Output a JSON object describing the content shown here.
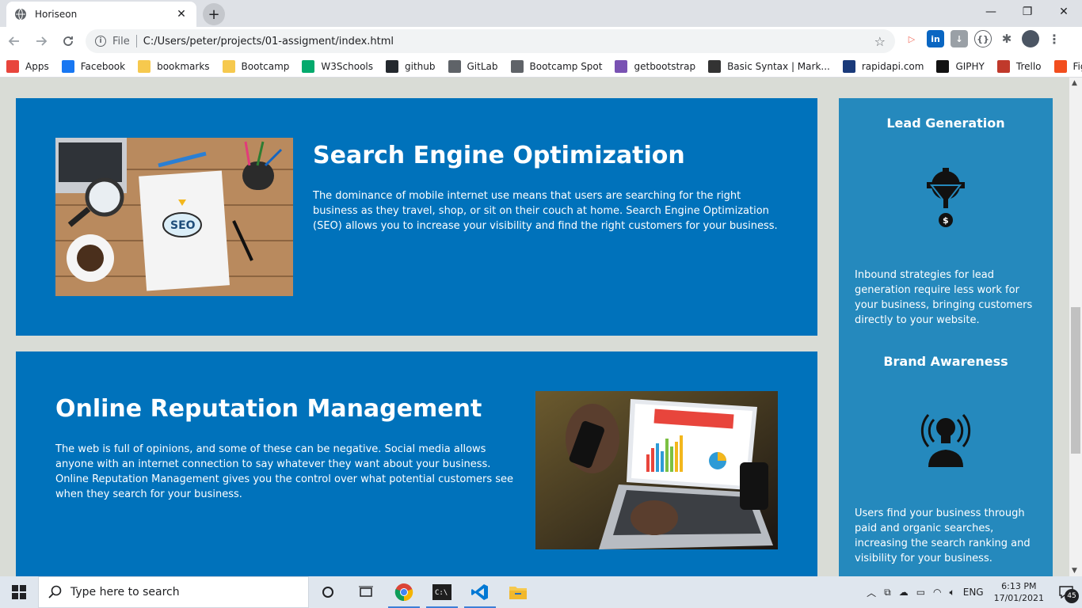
{
  "browser": {
    "tab_title": "Horiseon",
    "tab_close": "✕",
    "new_tab": "+",
    "window_controls": [
      "—",
      "❐",
      "✕"
    ],
    "scheme_label": "File",
    "url": "C:/Users/peter/projects/01-assigment/index.html",
    "bookmarks": [
      {
        "label": "Apps",
        "icon": "apps-grid-icon",
        "color": "#e8453c"
      },
      {
        "label": "Facebook",
        "icon": "facebook-icon",
        "color": "#1877f2"
      },
      {
        "label": "bookmarks",
        "icon": "folder-icon",
        "color": "#f6c94e"
      },
      {
        "label": "Bootcamp",
        "icon": "folder-icon",
        "color": "#f6c94e"
      },
      {
        "label": "W3Schools",
        "icon": "w3schools-icon",
        "color": "#04aa6d"
      },
      {
        "label": "github",
        "icon": "github-icon",
        "color": "#24292e"
      },
      {
        "label": "GitLab",
        "icon": "globe-icon",
        "color": "#5f6368"
      },
      {
        "label": "Bootcamp Spot",
        "icon": "globe-icon",
        "color": "#5f6368"
      },
      {
        "label": "getbootstrap",
        "icon": "bootstrap-icon",
        "color": "#7952b3"
      },
      {
        "label": "Basic Syntax | Mark...",
        "icon": "markdown-icon",
        "color": "#333333"
      },
      {
        "label": "rapidapi.com",
        "icon": "rapidapi-icon",
        "color": "#1a3a7a"
      },
      {
        "label": "GIPHY",
        "icon": "giphy-icon",
        "color": "#121212"
      },
      {
        "label": "Trello",
        "icon": "trello-icon",
        "color": "#c0392b"
      },
      {
        "label": "Figma",
        "icon": "figma-icon",
        "color": "#f24e1e"
      }
    ]
  },
  "content": {
    "seo": {
      "title": "Search Engine Optimization",
      "body": "The dominance of mobile internet use means that users are searching for the right business as they travel, shop, or sit on their couch at home. Search Engine Optimization (SEO) allows you to increase your visibility and find the right customers for your business."
    },
    "orm": {
      "title": "Online Reputation Management",
      "body": "The web is full of opinions, and some of these can be negative. Social media allows anyone with an internet connection to say whatever they want about your business. Online Reputation Management gives you the control over what potential customers see when they search for your business."
    }
  },
  "aside": {
    "lead": {
      "title": "Lead Generation",
      "body": "Inbound strategies for lead generation require less work for your business, bringing customers directly to your website."
    },
    "brand": {
      "title": "Brand Awareness",
      "body": "Users find your business through paid and organic searches, increasing the search ranking and visibility for your business."
    }
  },
  "taskbar": {
    "search_placeholder": "Type here to search",
    "language": "ENG",
    "time": "6:13 PM",
    "date": "17/01/2021",
    "notification_count": "45"
  },
  "colors": {
    "card_blue": "#0072bb",
    "aside_blue": "#2589bd",
    "page_bg": "#d9dcd6"
  }
}
